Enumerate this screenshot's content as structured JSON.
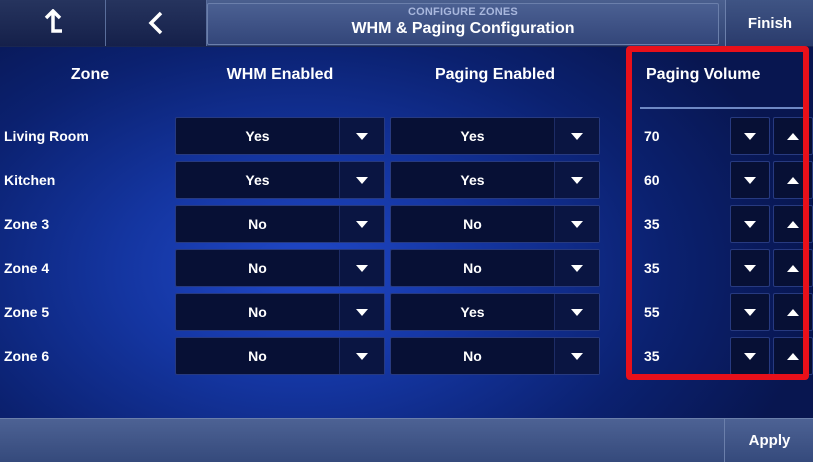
{
  "header": {
    "subtitle": "CONFIGURE ZONES",
    "title": "WHM & Paging Configuration",
    "finish_label": "Finish",
    "home_icon": "up-arrow-home-icon",
    "back_icon": "chevron-left-icon"
  },
  "columns": {
    "zone": "Zone",
    "whm": "WHM Enabled",
    "paging": "Paging Enabled",
    "volume": "Paging Volume"
  },
  "rows": [
    {
      "zone": "Living Room",
      "whm": "Yes",
      "paging": "Yes",
      "volume": "70"
    },
    {
      "zone": "Kitchen",
      "whm": "Yes",
      "paging": "Yes",
      "volume": "60"
    },
    {
      "zone": "Zone 3",
      "whm": "No",
      "paging": "No",
      "volume": "35"
    },
    {
      "zone": "Zone 4",
      "whm": "No",
      "paging": "No",
      "volume": "35"
    },
    {
      "zone": "Zone 5",
      "whm": "No",
      "paging": "Yes",
      "volume": "55"
    },
    {
      "zone": "Zone 6",
      "whm": "No",
      "paging": "No",
      "volume": "35"
    }
  ],
  "footer": {
    "apply_label": "Apply"
  },
  "colors": {
    "highlight": "#e8101a",
    "background": "#1435a0"
  }
}
